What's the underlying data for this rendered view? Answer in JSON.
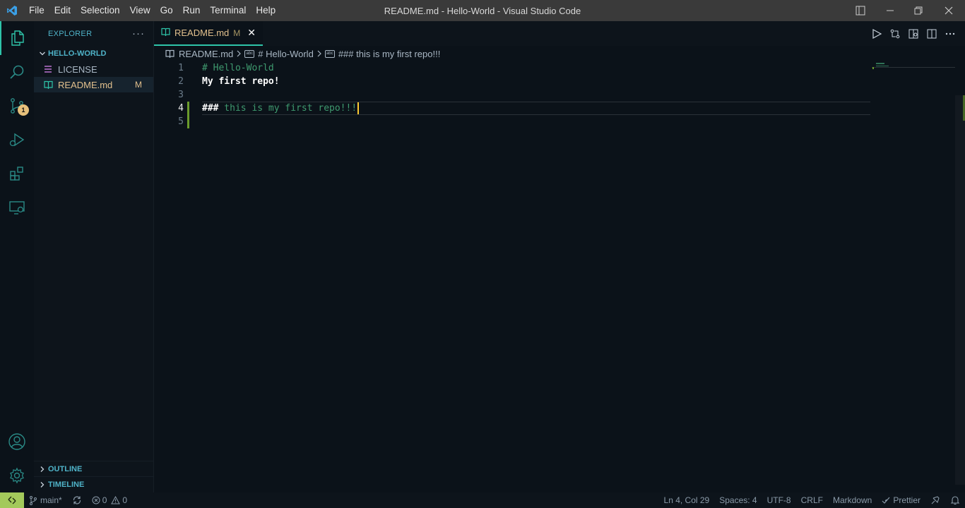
{
  "window": {
    "title": "README.md - Hello-World - Visual Studio Code",
    "menu": [
      "File",
      "Edit",
      "Selection",
      "View",
      "Go",
      "Run",
      "Terminal",
      "Help"
    ]
  },
  "activity_bar": {
    "items": [
      "explorer-icon",
      "search-icon",
      "source-control-icon",
      "run-debug-icon",
      "extensions-icon",
      "remote-explorer-icon"
    ],
    "source_control_badge": "1",
    "bottom": [
      "accounts-icon",
      "manage-gear-icon"
    ]
  },
  "sidebar": {
    "title": "EXPLORER",
    "more": "···",
    "folder": "HELLO-WORLD",
    "files": [
      {
        "name": "LICENSE",
        "status": ""
      },
      {
        "name": "README.md",
        "status": "M"
      }
    ],
    "outline": "OUTLINE",
    "timeline": "TIMELINE"
  },
  "editor": {
    "tab": {
      "label": "README.md",
      "status": "M",
      "close": "✕"
    },
    "breadcrumb": {
      "file": "README.md",
      "h1": "# Hello-World",
      "h3": "### this is my first repo!!!"
    },
    "lines": {
      "n1": "1",
      "n2": "2",
      "n3": "3",
      "n4": "4",
      "n5": "5",
      "l1_hash": "#",
      "l1_text": " Hello-World",
      "l2": "My first repo!",
      "l4_hash": "###",
      "l4_text": " this is my first repo!!!"
    },
    "current_line": 4
  },
  "statusbar": {
    "branch": "main*",
    "errors": "0",
    "warnings": "0",
    "position": "Ln 4, Col 29",
    "indent": "Spaces: 4",
    "encoding": "UTF-8",
    "eol": "CRLF",
    "language": "Markdown",
    "formatter": "Prettier"
  },
  "colors": {
    "accent": "#2ec4a9",
    "modified": "#e2c08d",
    "remote": "#a3c95b",
    "git_added": "#6a9b2c"
  }
}
